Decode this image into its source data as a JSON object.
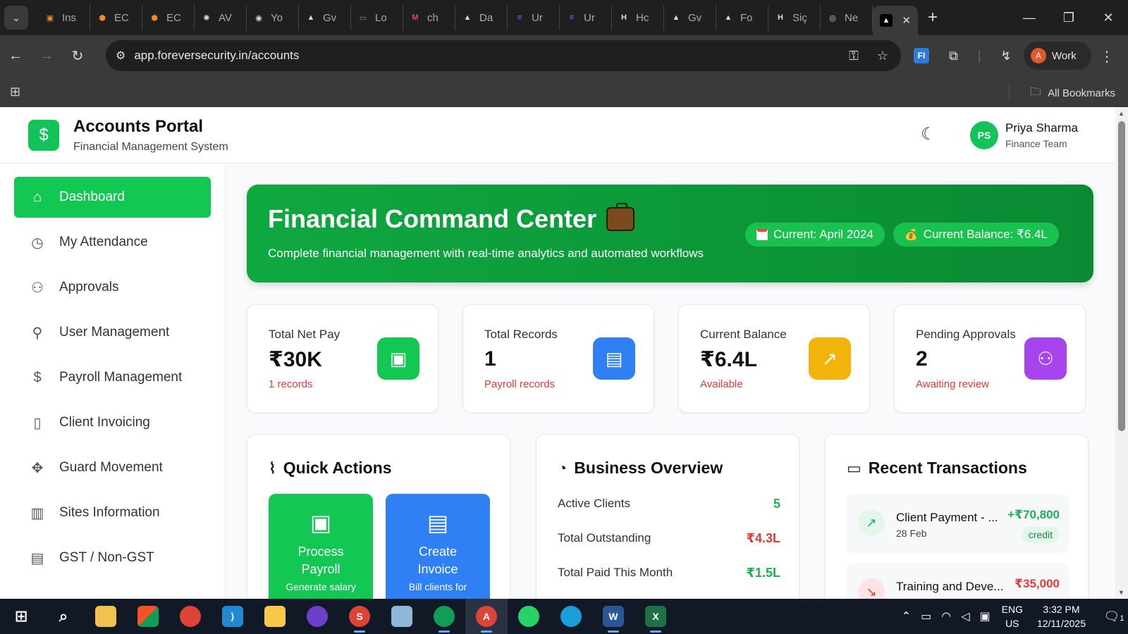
{
  "browser": {
    "tabs": [
      {
        "label": "Ins",
        "icon": "orange-square",
        "color": "#f08a24"
      },
      {
        "label": "EC",
        "icon": "aws-cube",
        "color": "#f08a24"
      },
      {
        "label": "EC",
        "icon": "aws-cube",
        "color": "#f08a24"
      },
      {
        "label": "AV",
        "icon": "openai-icon",
        "color": "#ddd"
      },
      {
        "label": "Yo",
        "icon": "github-icon",
        "color": "#ddd"
      },
      {
        "label": "Gv",
        "icon": "triangle-icon",
        "color": "#ddd"
      },
      {
        "label": "Lo",
        "icon": "gmx-icon",
        "color": "#888"
      },
      {
        "label": "ch",
        "icon": "gmail-icon",
        "color": "#e44"
      },
      {
        "label": "Da",
        "icon": "triangle-icon",
        "color": "#ddd"
      },
      {
        "label": "Ur",
        "icon": "docs-icon",
        "color": "#4a8af4"
      },
      {
        "label": "Ur",
        "icon": "docs-icon",
        "color": "#4a8af4"
      },
      {
        "label": "Hc",
        "icon": "h-icon",
        "color": "#ddd"
      },
      {
        "label": "Gv",
        "icon": "triangle-icon",
        "color": "#ddd"
      },
      {
        "label": "Fo",
        "icon": "triangle-icon",
        "color": "#ddd"
      },
      {
        "label": "Siç",
        "icon": "h-icon",
        "color": "#ddd"
      },
      {
        "label": "Ne",
        "icon": "chrome-icon",
        "color": "#ddd"
      }
    ],
    "url": "app.foreversecurity.in/accounts",
    "profile_label": "Work",
    "profile_initial": "A",
    "all_bookmarks": "All Bookmarks"
  },
  "header": {
    "logo_symbol": "$",
    "title": "Accounts Portal",
    "subtitle": "Financial Management System",
    "user_initials": "PS",
    "user_name": "Priya Sharma",
    "user_role": "Finance Team"
  },
  "sidebar": {
    "items": [
      {
        "label": "Dashboard",
        "icon": "home-icon",
        "active": true
      },
      {
        "label": "My Attendance",
        "icon": "clock-icon"
      },
      {
        "label": "Approvals",
        "icon": "users-icon"
      },
      {
        "label": "User Management",
        "icon": "user-plus-icon"
      },
      {
        "label": "Payroll Management",
        "icon": "dollar-icon"
      },
      {
        "label": "Client Invoicing",
        "icon": "book-icon"
      },
      {
        "label": "Guard Movement",
        "icon": "move-icon"
      },
      {
        "label": "Sites Information",
        "icon": "map-icon"
      },
      {
        "label": "GST / Non-GST",
        "icon": "file-text-icon"
      }
    ]
  },
  "hero": {
    "title": "Financial Command Center",
    "subtitle": "Complete financial management with real-time analytics and automated workflows",
    "current_period": "Current: April 2024",
    "current_balance": "Current Balance: ₹6.4L"
  },
  "stats": [
    {
      "label": "Total Net Pay",
      "value": "₹30K",
      "note": "1 records",
      "icon": "wallet-icon",
      "color": "#12c853"
    },
    {
      "label": "Total Records",
      "value": "1",
      "note": "Payroll records",
      "icon": "clipboard-icon",
      "color": "#2f7ff5"
    },
    {
      "label": "Current Balance",
      "value": "₹6.4L",
      "note": "Available",
      "icon": "trending-up-icon",
      "color": "#f2b40b"
    },
    {
      "label": "Pending Approvals",
      "value": "2",
      "note": "Awaiting review",
      "icon": "users-icon",
      "color": "#a843f0"
    }
  ],
  "quick_actions": {
    "title": "Quick Actions",
    "buttons": [
      {
        "title": "Process Payroll",
        "subtitle": "Generate salary",
        "icon": "wallet-icon",
        "color": "#12c853"
      },
      {
        "title": "Create Invoice",
        "subtitle": "Bill clients for",
        "icon": "file-text-icon",
        "color": "#2f7ff5"
      }
    ]
  },
  "business_overview": {
    "title": "Business Overview",
    "rows": [
      {
        "label": "Active Clients",
        "value": "5",
        "color": "#1db056"
      },
      {
        "label": "Total Outstanding",
        "value": "₹4.3L",
        "color": "#e53935"
      },
      {
        "label": "Total Paid This Month",
        "value": "₹1.5L",
        "color": "#1db056"
      }
    ]
  },
  "recent_transactions": {
    "title": "Recent Transactions",
    "items": [
      {
        "name": "Client Payment - ...",
        "date": "28 Feb",
        "amount": "+₹70,800",
        "type": "credit",
        "color": "#1db056"
      },
      {
        "name": "Training and Deve...",
        "date": "",
        "amount": "₹35,000",
        "type": "",
        "color": "#e53935"
      }
    ]
  },
  "taskbar": {
    "lang_top": "ENG",
    "lang_bottom": "US",
    "time": "3:32 PM",
    "date": "12/11/2025",
    "notif_count": "1"
  }
}
